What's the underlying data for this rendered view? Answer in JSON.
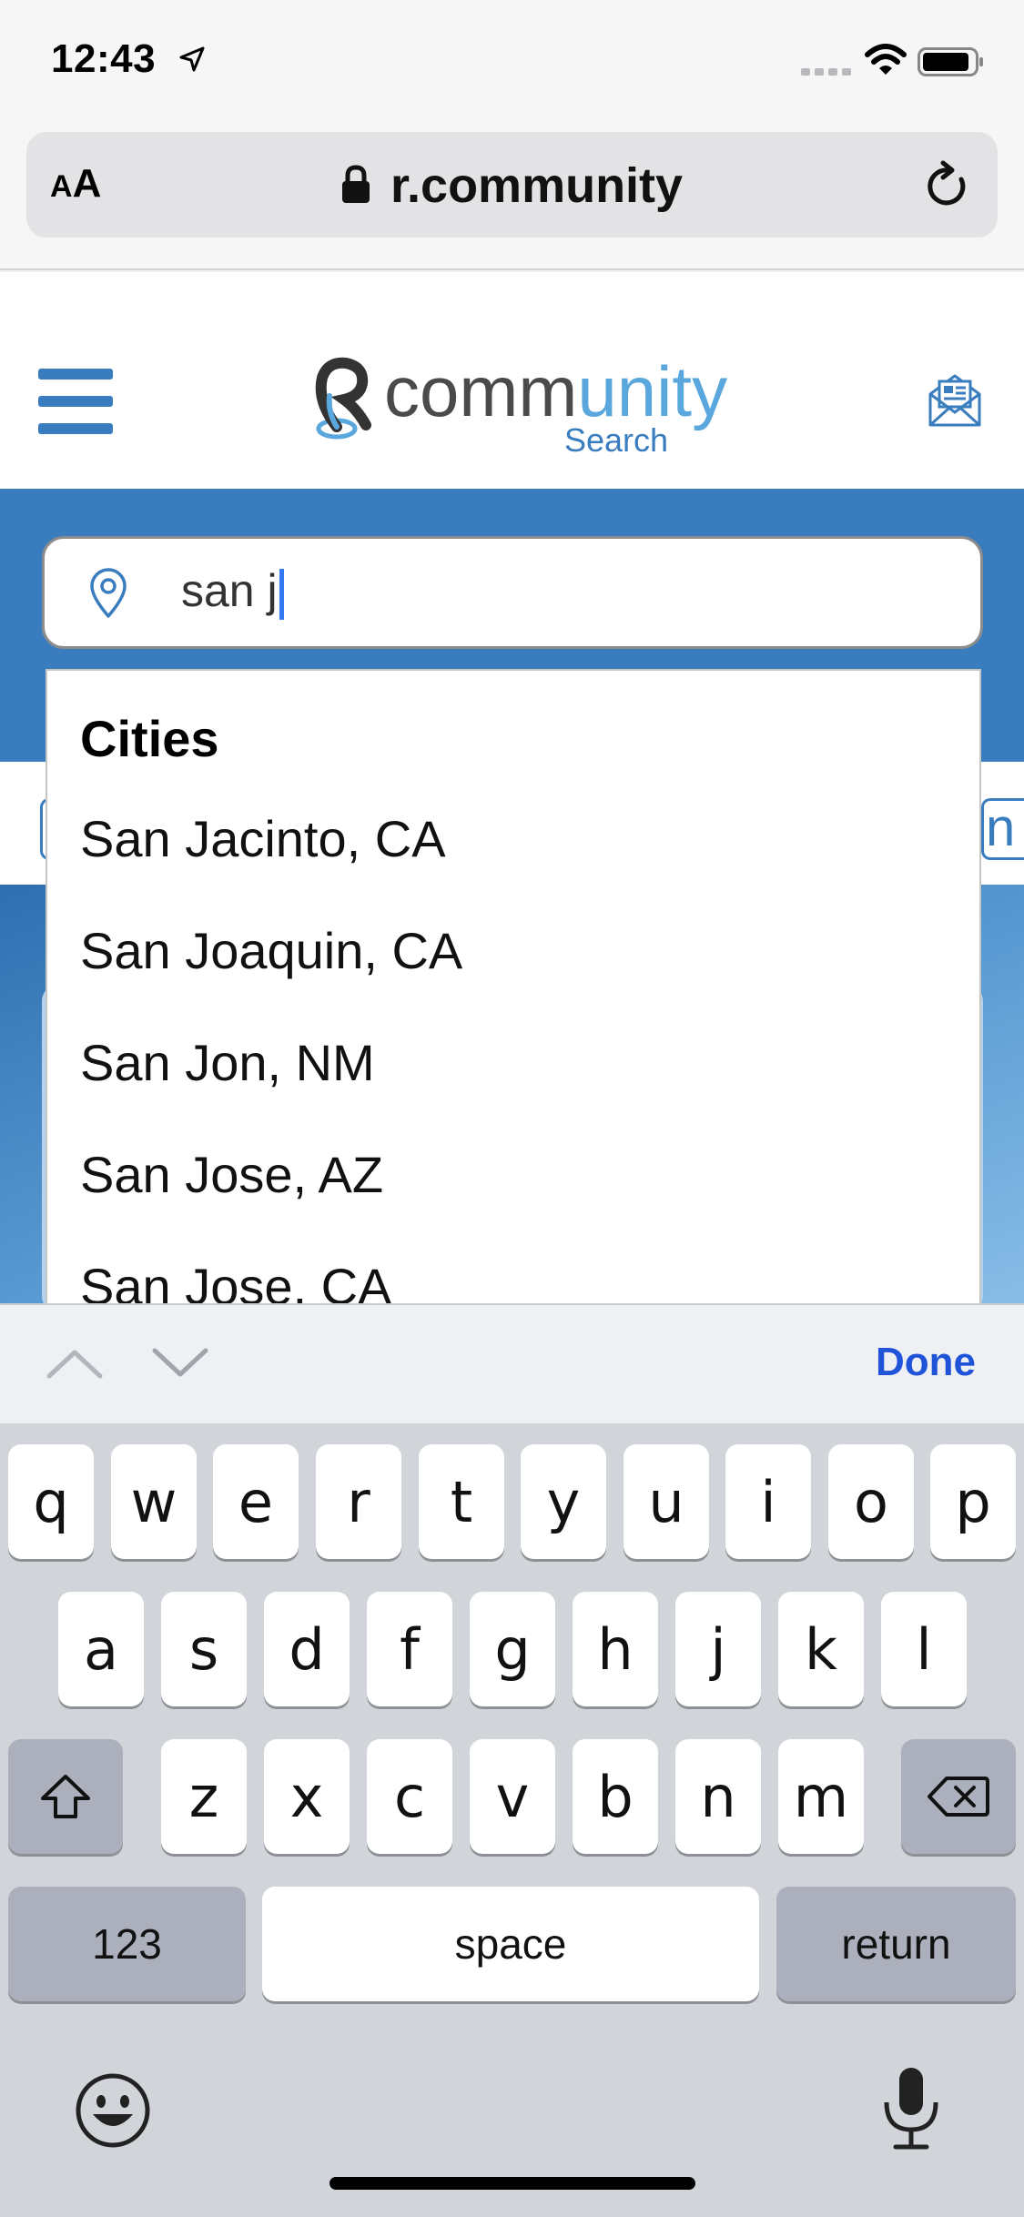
{
  "status_bar": {
    "time": "12:43"
  },
  "browser": {
    "aa_label_small": "A",
    "aa_label_large": "A",
    "url": "r.community"
  },
  "site": {
    "logo_part1": "comm",
    "logo_part2": "unity",
    "logo_sub": "Search"
  },
  "search": {
    "value": "san j"
  },
  "background_fragment_right": "n",
  "dropdown": {
    "heading": "Cities",
    "items": [
      "San Jacinto, CA",
      "San Joaquin, CA",
      "San Jon, NM",
      "San Jose, AZ",
      "San Jose, CA"
    ]
  },
  "accessory": {
    "done_label": "Done"
  },
  "keyboard": {
    "row1": [
      "q",
      "w",
      "e",
      "r",
      "t",
      "y",
      "u",
      "i",
      "o",
      "p"
    ],
    "row2": [
      "a",
      "s",
      "d",
      "f",
      "g",
      "h",
      "j",
      "k",
      "l"
    ],
    "row3": [
      "z",
      "x",
      "c",
      "v",
      "b",
      "n",
      "m"
    ],
    "numbers_label": "123",
    "space_label": "space",
    "return_label": "return"
  },
  "colors": {
    "brand_blue": "#3a7dbf",
    "logo_light_blue": "#5aa7dd",
    "done_blue": "#1f54d9"
  },
  "icons": [
    "location-arrow-icon",
    "wifi-icon",
    "battery-icon",
    "lock-icon",
    "reload-icon",
    "hamburger-menu-icon",
    "newsletter-icon",
    "map-pin-icon",
    "chevron-up-icon",
    "chevron-down-icon",
    "shift-icon",
    "backspace-icon",
    "emoji-icon",
    "microphone-icon"
  ]
}
